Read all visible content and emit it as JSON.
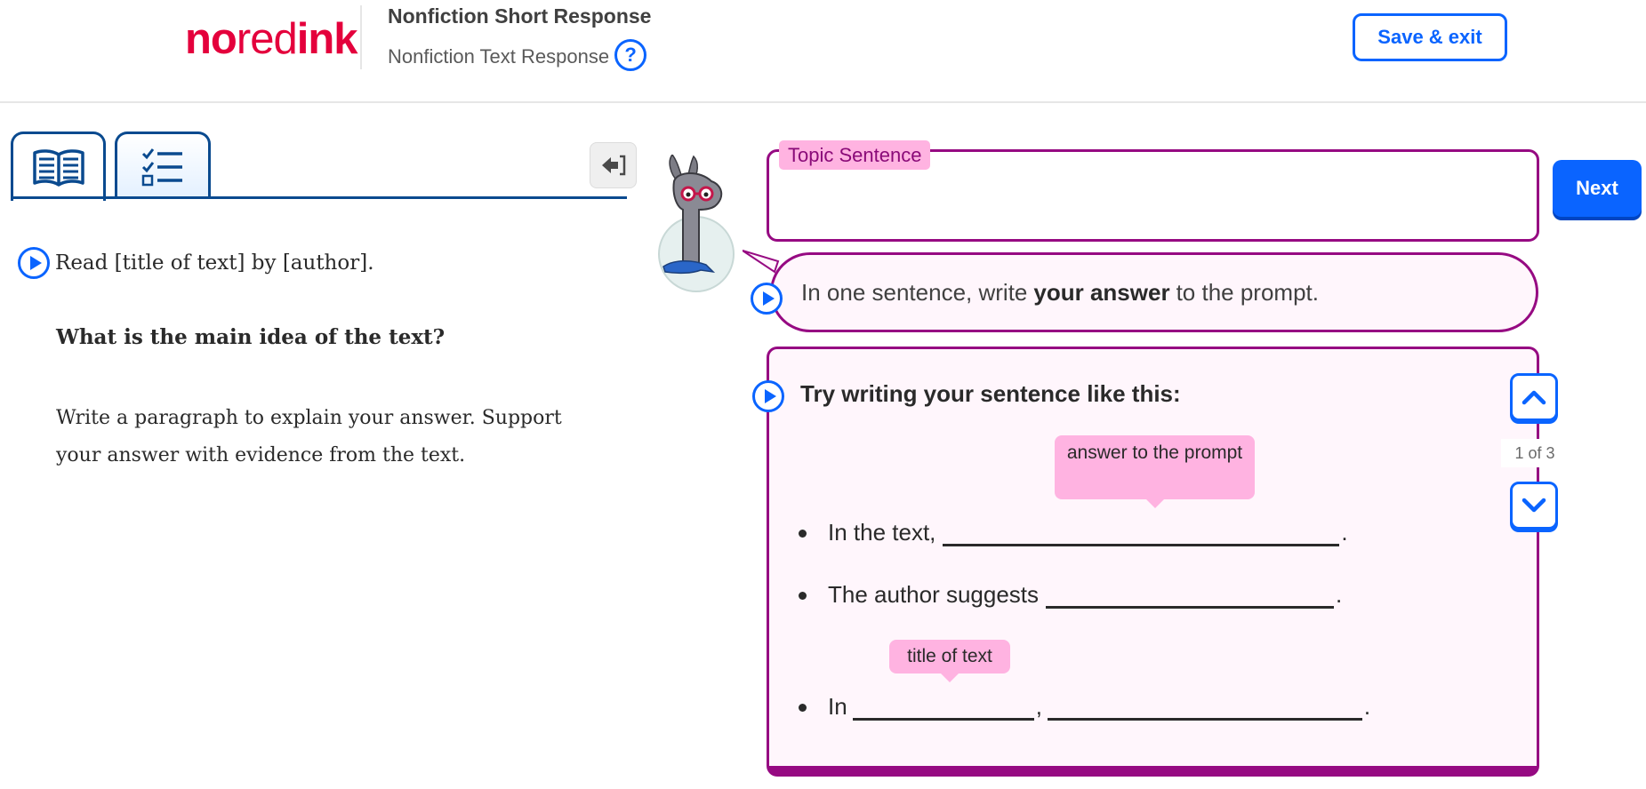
{
  "header": {
    "logo": {
      "part1": "no",
      "part2": "red",
      "part3": "ink"
    },
    "activity_title": "Nonfiction Short Response",
    "activity_subtitle": "Nonfiction Text Response",
    "help_icon_text": "?",
    "save_exit_label": "Save & exit"
  },
  "left_panel": {
    "tabs": [
      {
        "name": "reading",
        "icon": "book-icon"
      },
      {
        "name": "checklist",
        "icon": "checklist-icon"
      }
    ],
    "collapse_icon": "collapse-left-icon",
    "read_line": "Read [title of text] by [author].",
    "question": "What is the main idea of the text?",
    "instructions": "Write a paragraph to explain your answer. Support your answer with evidence from the text."
  },
  "right_panel": {
    "topic_label": "Topic Sentence",
    "topic_value": "",
    "next_label": "Next",
    "bubble": {
      "before": "In one sentence, write",
      "bold": "your answer",
      "after": "to the prompt."
    },
    "guide": {
      "title": "Try writing your sentence like this:",
      "tip_answer": "answer to the prompt",
      "tip_title": "title of text",
      "sentences": [
        {
          "start": "In the text,",
          "end": "."
        },
        {
          "start": "The author suggests",
          "end": "."
        },
        {
          "start": "In",
          "middle": ",",
          "end": "."
        }
      ],
      "counter": "1 of 3"
    },
    "colors": {
      "accent": "#960a82",
      "label_bg": "#ffb3e1",
      "primary": "#0a64ff"
    }
  }
}
